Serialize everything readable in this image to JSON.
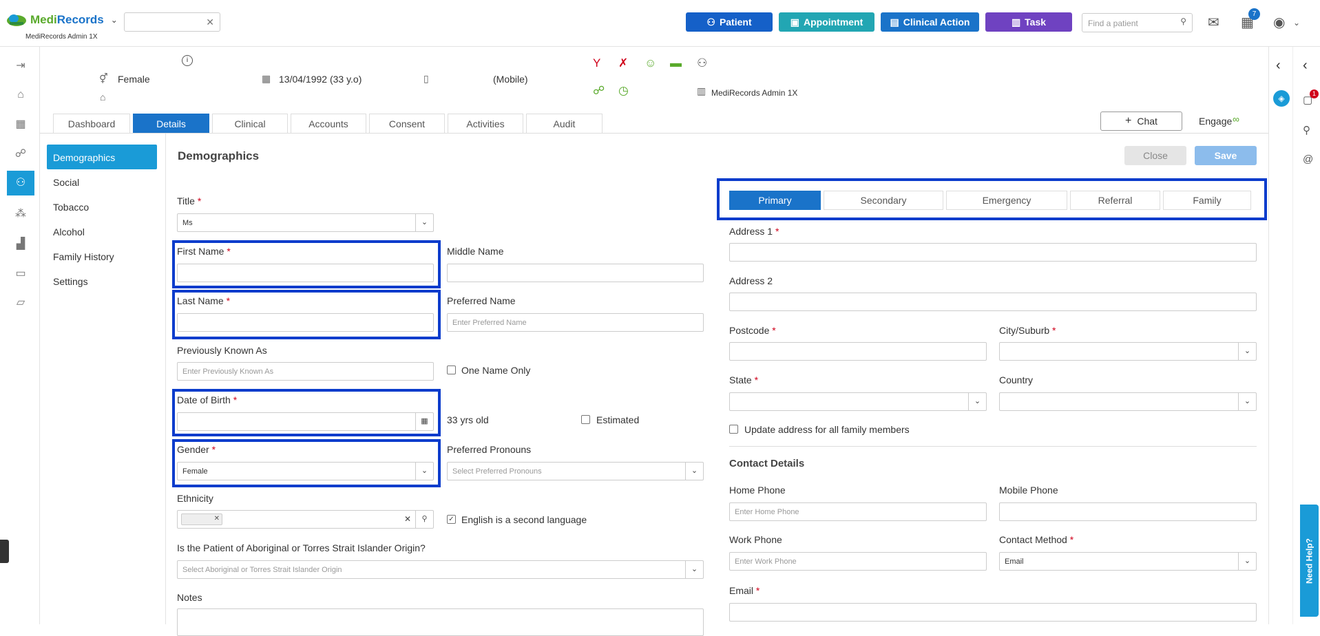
{
  "app": {
    "name_prefix": "Medi",
    "name_suffix": "Records",
    "subtitle": "MediRecords Admin 1X"
  },
  "topbar": {
    "buttons": [
      {
        "label": "Patient",
        "color": "#1560c8"
      },
      {
        "label": "Appointment",
        "color": "#22a6b3"
      },
      {
        "label": "Clinical Action",
        "color": "#1a73c9"
      },
      {
        "label": "Task",
        "color": "#6f42c1"
      }
    ],
    "find_placeholder": "Find a patient",
    "tasks_badge": "7"
  },
  "patient": {
    "gender": "Female",
    "dob": "13/04/1992 (33 y.o)",
    "mobile": "(Mobile)",
    "practice": "MediRecords Admin 1X"
  },
  "tabs": [
    "Dashboard",
    "Details",
    "Clinical",
    "Accounts",
    "Consent",
    "Activities",
    "Audit"
  ],
  "active_tab": "Details",
  "chat_label": "Chat",
  "engage_label": "Engage",
  "side_menu": [
    "Demographics",
    "Social",
    "Tobacco",
    "Alcohol",
    "Family History",
    "Settings"
  ],
  "section_title": "Demographics",
  "actions": {
    "close": "Close",
    "save": "Save"
  },
  "form": {
    "title_label": "Title",
    "title_value": "Ms",
    "first_name_label": "First Name",
    "middle_name_label": "Middle Name",
    "last_name_label": "Last Name",
    "preferred_name_label": "Preferred Name",
    "preferred_name_placeholder": "Enter Preferred Name",
    "prev_known_label": "Previously Known As",
    "prev_known_placeholder": "Enter Previously Known As",
    "one_name_label": "One Name Only",
    "dob_label": "Date of Birth",
    "age_text": "33 yrs old",
    "estimated_label": "Estimated",
    "gender_label": "Gender",
    "gender_value": "Female",
    "pronouns_label": "Preferred Pronouns",
    "pronouns_placeholder": "Select Preferred Pronouns",
    "ethnicity_label": "Ethnicity",
    "english_second_label": "English is a second language",
    "aboriginal_label": "Is the Patient of Aboriginal or Torres Strait Islander Origin?",
    "aboriginal_placeholder": "Select Aboriginal or Torres Strait Islander Origin",
    "notes_label": "Notes"
  },
  "address_tabs": [
    "Primary",
    "Secondary",
    "Emergency",
    "Referral",
    "Family"
  ],
  "address": {
    "address1_label": "Address 1",
    "address2_label": "Address 2",
    "postcode_label": "Postcode",
    "city_label": "City/Suburb",
    "state_label": "State",
    "country_label": "Country",
    "update_family_label": "Update address for all family members"
  },
  "contact": {
    "title": "Contact Details",
    "home_phone_label": "Home Phone",
    "home_phone_placeholder": "Enter Home Phone",
    "mobile_phone_label": "Mobile Phone",
    "work_phone_label": "Work Phone",
    "work_phone_placeholder": "Enter Work Phone",
    "contact_method_label": "Contact Method",
    "contact_method_value": "Email",
    "email_label": "Email"
  },
  "help_label": "Need Help?",
  "notif_badge": "1"
}
